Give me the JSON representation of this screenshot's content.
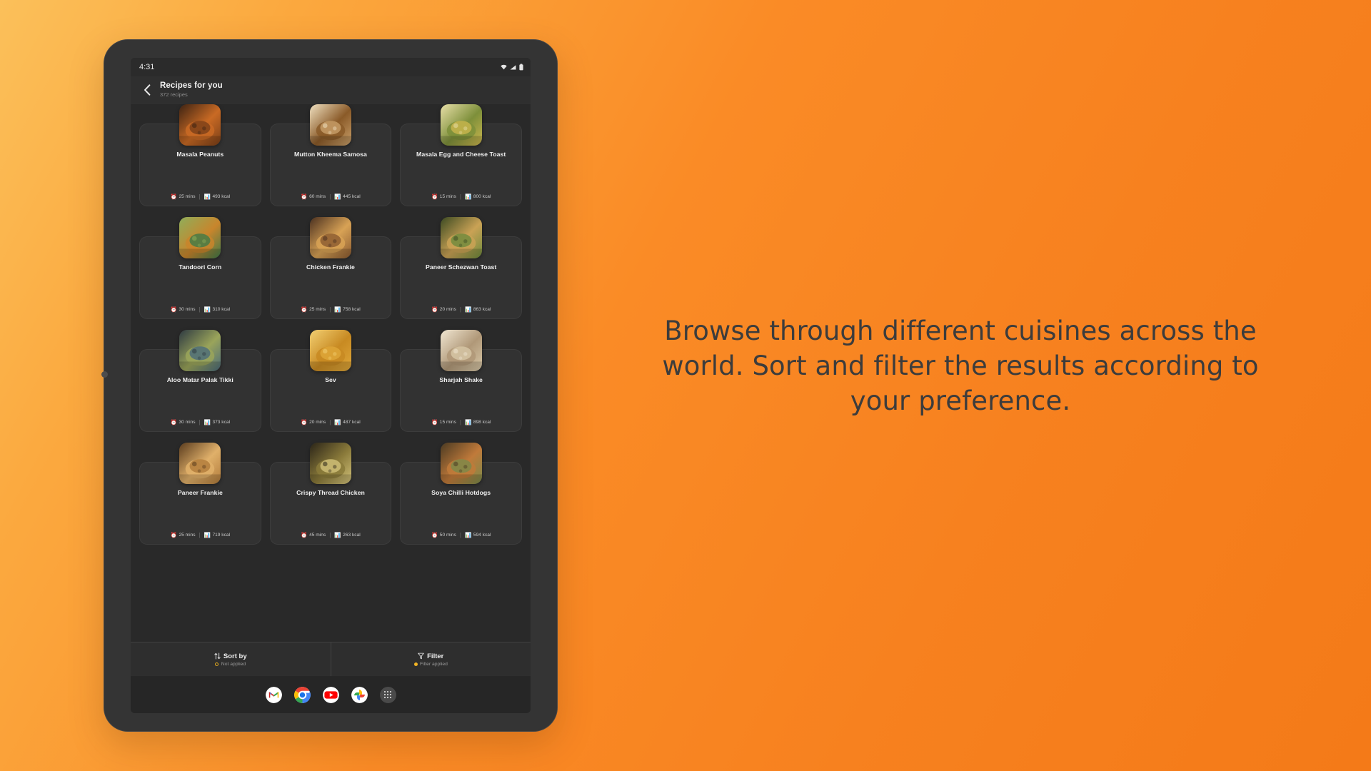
{
  "caption": "Browse through different cuisines across the world. Sort and filter the results according to your preference.",
  "device": {
    "statusbar": {
      "time": "4:31",
      "icons": [
        "wifi-icon",
        "signal-icon",
        "battery-icon"
      ]
    }
  },
  "appbar": {
    "back_icon": "chevron-left-icon",
    "title": "Recipes for you",
    "subtitle": "372 recipes"
  },
  "recipes": [
    {
      "name": "Masala Peanuts",
      "time": "25 mins",
      "kcal": "493 kcal"
    },
    {
      "name": "Mutton Kheema Samosa",
      "time": "60 mins",
      "kcal": "445 kcal"
    },
    {
      "name": "Masala Egg and Cheese Toast",
      "time": "15 mins",
      "kcal": "800 kcal"
    },
    {
      "name": "Tandoori Corn",
      "time": "30 mins",
      "kcal": "310 kcal"
    },
    {
      "name": "Chicken Frankie",
      "time": "25 mins",
      "kcal": "758 kcal"
    },
    {
      "name": "Paneer Schezwan Toast",
      "time": "20 mins",
      "kcal": "863 kcal"
    },
    {
      "name": "Aloo Matar Palak Tikki",
      "time": "30 mins",
      "kcal": "373 kcal"
    },
    {
      "name": "Sev",
      "time": "20 mins",
      "kcal": "487 kcal"
    },
    {
      "name": "Sharjah Shake",
      "time": "15 mins",
      "kcal": "898 kcal"
    },
    {
      "name": "Paneer Frankie",
      "time": "25 mins",
      "kcal": "719 kcal"
    },
    {
      "name": "Crispy Thread Chicken",
      "time": "45 mins",
      "kcal": "263 kcal"
    },
    {
      "name": "Soya Chilli Hotdogs",
      "time": "50 mins",
      "kcal": "594 kcal"
    }
  ],
  "meta_icons": {
    "time": "alarm-clock-icon",
    "calories": "calories-icon"
  },
  "actionbar": {
    "sort": {
      "icon": "sort-arrows-icon",
      "label": "Sort by",
      "status": "Not applied",
      "status_state": "inactive"
    },
    "filter": {
      "icon": "filter-funnel-icon",
      "label": "Filter",
      "status": "Filter applied",
      "status_state": "active"
    }
  },
  "dock": [
    {
      "name": "gmail-icon"
    },
    {
      "name": "chrome-icon"
    },
    {
      "name": "youtube-icon"
    },
    {
      "name": "google-photos-icon"
    },
    {
      "name": "app-drawer-icon"
    }
  ],
  "colors": {
    "background_start": "#fbc05a",
    "background_end": "#f47a18",
    "accent_time": "#e8b923",
    "accent_kcal": "#34a877",
    "accent_filter": "#f2b424",
    "surface": "#323232",
    "screen_bg": "#292929"
  }
}
